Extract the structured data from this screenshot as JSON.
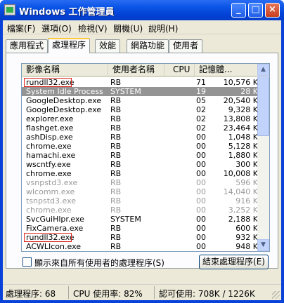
{
  "window": {
    "title": "Windows 工作管理員",
    "icons": {
      "app": "task-manager-icon",
      "minimize": "minimize-icon",
      "maximize": "maximize-icon",
      "close": "close-icon"
    }
  },
  "menu": {
    "items": [
      "檔案(F)",
      "選項(O)",
      "檢視(V)",
      "關機(U)",
      "說明(H)"
    ]
  },
  "tabs": {
    "items": [
      "應用程式",
      "處理程序",
      "效能",
      "網路功能",
      "使用者"
    ],
    "active": "處理程序"
  },
  "table": {
    "columns": [
      "影像名稱",
      "使用者名稱",
      "CPU",
      "記憶體..."
    ],
    "rows": [
      {
        "name": "rundll32.exe",
        "user": "RB",
        "cpu": "71",
        "mem": "10,576 K"
      },
      {
        "name": "System Idle Process",
        "user": "SYSTEM",
        "cpu": "19",
        "mem": "28 K"
      },
      {
        "name": "GoogleDesktop.exe",
        "user": "RB",
        "cpu": "05",
        "mem": "20,540 K"
      },
      {
        "name": "GoogleDesktop.exe",
        "user": "RB",
        "cpu": "02",
        "mem": "9,328 K"
      },
      {
        "name": "explorer.exe",
        "user": "RB",
        "cpu": "02",
        "mem": "13,808 K"
      },
      {
        "name": "flashget.exe",
        "user": "RB",
        "cpu": "02",
        "mem": "23,464 K"
      },
      {
        "name": "ashDisp.exe",
        "user": "RB",
        "cpu": "00",
        "mem": "1,048 K"
      },
      {
        "name": "chrome.exe",
        "user": "RB",
        "cpu": "00",
        "mem": "5,128 K"
      },
      {
        "name": "hamachi.exe",
        "user": "RB",
        "cpu": "00",
        "mem": "1,880 K"
      },
      {
        "name": "wscntfy.exe",
        "user": "RB",
        "cpu": "00",
        "mem": "300 K"
      },
      {
        "name": "chrome.exe",
        "user": "RB",
        "cpu": "00",
        "mem": "10,008 K"
      },
      {
        "name": "vsnpstd3.exe",
        "user": "RB",
        "cpu": "00",
        "mem": "596 K"
      },
      {
        "name": "wlcomm.exe",
        "user": "RB",
        "cpu": "00",
        "mem": "14,040 K"
      },
      {
        "name": "tsnpstd3.exe",
        "user": "RB",
        "cpu": "00",
        "mem": "916 K"
      },
      {
        "name": "chrome.exe",
        "user": "RB",
        "cpu": "00",
        "mem": "3,252 K"
      },
      {
        "name": "SvcGuiHlpr.exe",
        "user": "SYSTEM",
        "cpu": "00",
        "mem": "2,188 K"
      },
      {
        "name": "FixCamera.exe",
        "user": "RB",
        "cpu": "00",
        "mem": "600 K"
      },
      {
        "name": "rundll32.exe",
        "user": "RB",
        "cpu": "00",
        "mem": "932 K"
      },
      {
        "name": "ACWLIcon.exe",
        "user": "RB",
        "cpu": "00",
        "mem": "948 K"
      }
    ],
    "selected_index": 1,
    "faded_indices": [
      11,
      12,
      13,
      14
    ],
    "highlighted_indices": [
      0,
      17
    ],
    "highlight_color": "#e0201a"
  },
  "controls": {
    "show_all_label": "顯示來自所有使用者的處理程序(S)",
    "show_all_checked": false,
    "end_process_label": "結束處理程序(E)"
  },
  "status": {
    "processes": "處理程序: 68",
    "cpu": "CPU 使用率: 82%",
    "commit": "認可使用: 708K / 1226K"
  }
}
